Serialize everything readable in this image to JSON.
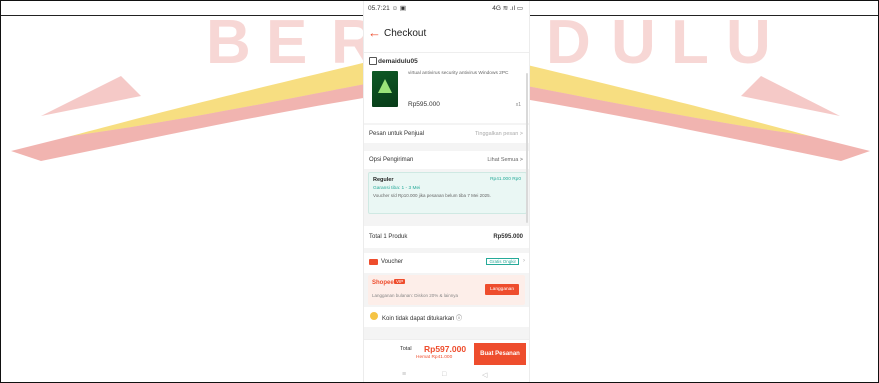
{
  "status_bar": {
    "time": "05.7:21 ☺ ▣",
    "icons": "4G ≋ .ıl ▭"
  },
  "header": {
    "back_icon": "←",
    "title": "Checkout"
  },
  "shop": {
    "name": "demaidulu05"
  },
  "product": {
    "name": "virtual antivirus security antivirus Windows 2PC",
    "price": "Rp595.000",
    "qty": "x1"
  },
  "seller_note": {
    "label": "Pesan untuk Penjual",
    "placeholder": "Tinggalkan pesan >"
  },
  "shipping_option": {
    "label": "Opsi Pengiriman",
    "link": "Lihat Semua >"
  },
  "shipping": {
    "name": "Reguler",
    "price": "Rp41.000 Rp0",
    "estimate": "Garansi tiba: 1 - 3 Mei",
    "note": "Voucher s/d Rp10.000 jika pesanan belum tiba 7 Mei 2025."
  },
  "total_products": {
    "label": "Total 1 Produk",
    "value": "Rp595.000"
  },
  "voucher": {
    "label": "Voucher",
    "badge": "Gratis Ongkir"
  },
  "shopee_vip": {
    "brand": "Shopee",
    "tag": "VIP",
    "desc": "Langganan bulanan: Diskon 20% & lainnya",
    "button": "Langganan"
  },
  "coins": {
    "label": "Koin tidak dapat ditukarkan ⓘ"
  },
  "bottom_bar": {
    "total_label": "Total",
    "total_value": "Rp597.000",
    "savings": "Hemat Rp41.000",
    "order_button": "Buat Pesanan"
  },
  "nav": {
    "menu": "≡",
    "home": "□",
    "back": "◁"
  },
  "colors": {
    "accent": "#ee4d2d",
    "teal": "#26aa99",
    "banner_red": "#d8281e",
    "banner_gold": "#f0c21a"
  }
}
